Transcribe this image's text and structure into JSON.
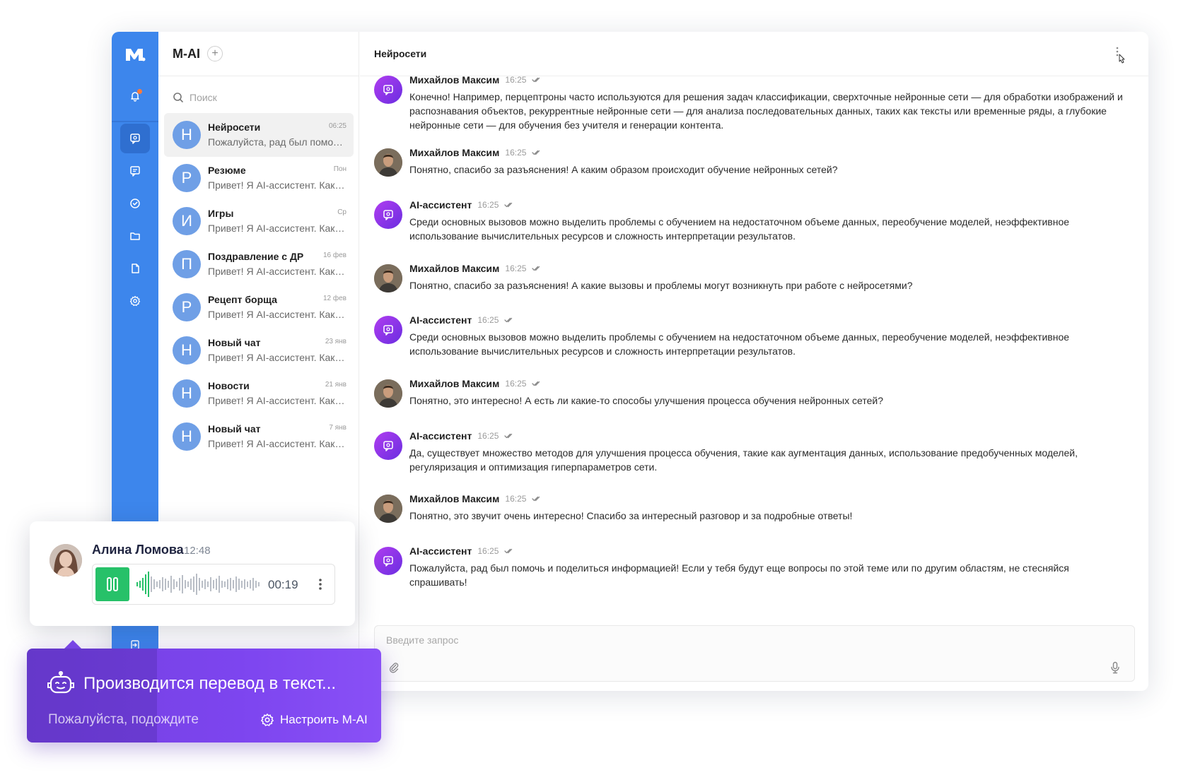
{
  "app": {
    "title": "M-AI",
    "add_label": "+"
  },
  "colors": {
    "rail": "#3d86ec",
    "accent_purple": "#7d45ef",
    "voice_green": "#27c169",
    "notification": "#ff7a3a"
  },
  "rail": {
    "icons": [
      "logo-icon",
      "bell-icon",
      "ai-chat-icon",
      "message-icon",
      "check-circle-icon",
      "folder-icon",
      "file-icon",
      "settings-icon",
      "logout-icon"
    ]
  },
  "search": {
    "placeholder": "Поиск"
  },
  "chats": [
    {
      "initial": "Н",
      "name": "Нейросети",
      "time": "06:25",
      "preview": "Пожалуйста, рад был помочь и поделиться информацией!"
    },
    {
      "initial": "Р",
      "name": "Резюме",
      "time": "Пон",
      "preview": "Привет! Я AI-ассистент. Как я могу помочь?"
    },
    {
      "initial": "И",
      "name": "Игры",
      "time": "Ср",
      "preview": "Привет! Я AI-ассистент. Как я могу помочь?"
    },
    {
      "initial": "П",
      "name": "Поздравление с ДР",
      "time": "16 фев",
      "preview": "Привет! Я AI-ассистент. Как я могу помочь?"
    },
    {
      "initial": "Р",
      "name": "Рецепт борща",
      "time": "12 фев",
      "preview": "Привет! Я AI-ассистент. Как я могу помочь?"
    },
    {
      "initial": "Н",
      "name": "Новый чат",
      "time": "23 янв",
      "preview": "Привет! Я AI-ассистент. Как я могу помочь?"
    },
    {
      "initial": "Н",
      "name": "Новости",
      "time": "21 янв",
      "preview": "Привет! Я AI-ассистент. Как я могу помочь?"
    },
    {
      "initial": "Н",
      "name": "Новый чат",
      "time": "7 янв",
      "preview": "Привет! Я AI-ассистент. Как я могу помочь?"
    }
  ],
  "conversation": {
    "title": "Нейросети",
    "messages": [
      {
        "author": "Михайлов Максим",
        "kind": "ai",
        "time": "16:25",
        "text": "Конечно! Например, перцептроны часто используются для решения задач классификации, сверхточные нейронные сети — для обработки изображений и распознавания объектов, рекуррентные нейронные сети — для анализа последовательных данных, таких как тексты или временные ряды, а глубокие нейронные сети — для обучения без учителя и генерации контента."
      },
      {
        "author": "Михайлов Максим",
        "kind": "user",
        "time": "16:25",
        "text": "Понятно, спасибо за разъяснения! А каким образом происходит обучение нейронных сетей?"
      },
      {
        "author": "AI-ассистент",
        "kind": "ai",
        "time": "16:25",
        "text": "Среди основных вызовов можно выделить проблемы с обучением на недостаточном объеме данных, переобучение моделей, неэффективное использование вычислительных ресурсов и сложность интерпретации результатов."
      },
      {
        "author": "Михайлов Максим",
        "kind": "user",
        "time": "16:25",
        "text": "Понятно, спасибо за разъяснения! А какие вызовы и проблемы могут возникнуть при работе с нейросетями?"
      },
      {
        "author": "AI-ассистент",
        "kind": "ai",
        "time": "16:25",
        "text": "Среди основных вызовов можно выделить проблемы с обучением на недостаточном объеме данных, переобучение моделей, неэффективное использование вычислительных ресурсов и сложность интерпретации результатов."
      },
      {
        "author": "Михайлов Максим",
        "kind": "user",
        "time": "16:25",
        "text": "Понятно, это интересно! А есть ли какие-то способы улучшения процесса обучения нейронных сетей?"
      },
      {
        "author": "AI-ассистент",
        "kind": "ai",
        "time": "16:25",
        "text": "Да, существует множество методов для улучшения процесса обучения, такие как аугментация данных, использование предобученных моделей, регуляризация и оптимизация гиперпараметров сети."
      },
      {
        "author": "Михайлов Максим",
        "kind": "user",
        "time": "16:25",
        "text": "Понятно, это звучит очень интересно! Спасибо за интересный разговор и за подробные ответы!"
      },
      {
        "author": "AI-ассистент",
        "kind": "ai",
        "time": "16:25",
        "text": "Пожалуйста, рад был помочь и поделиться информацией! Если у тебя будут еще вопросы по этой теме или по другим областям, не стесняйся спрашивать!"
      }
    ]
  },
  "composer": {
    "placeholder": "Введите запрос"
  },
  "voice_card": {
    "name": "Алина Ломова",
    "time": "12:48",
    "duration": "00:19"
  },
  "banner": {
    "title": "Производится перевод в текст...",
    "subtitle": "Пожалуйста, подождите",
    "settings_label": "Настроить M-AI"
  }
}
